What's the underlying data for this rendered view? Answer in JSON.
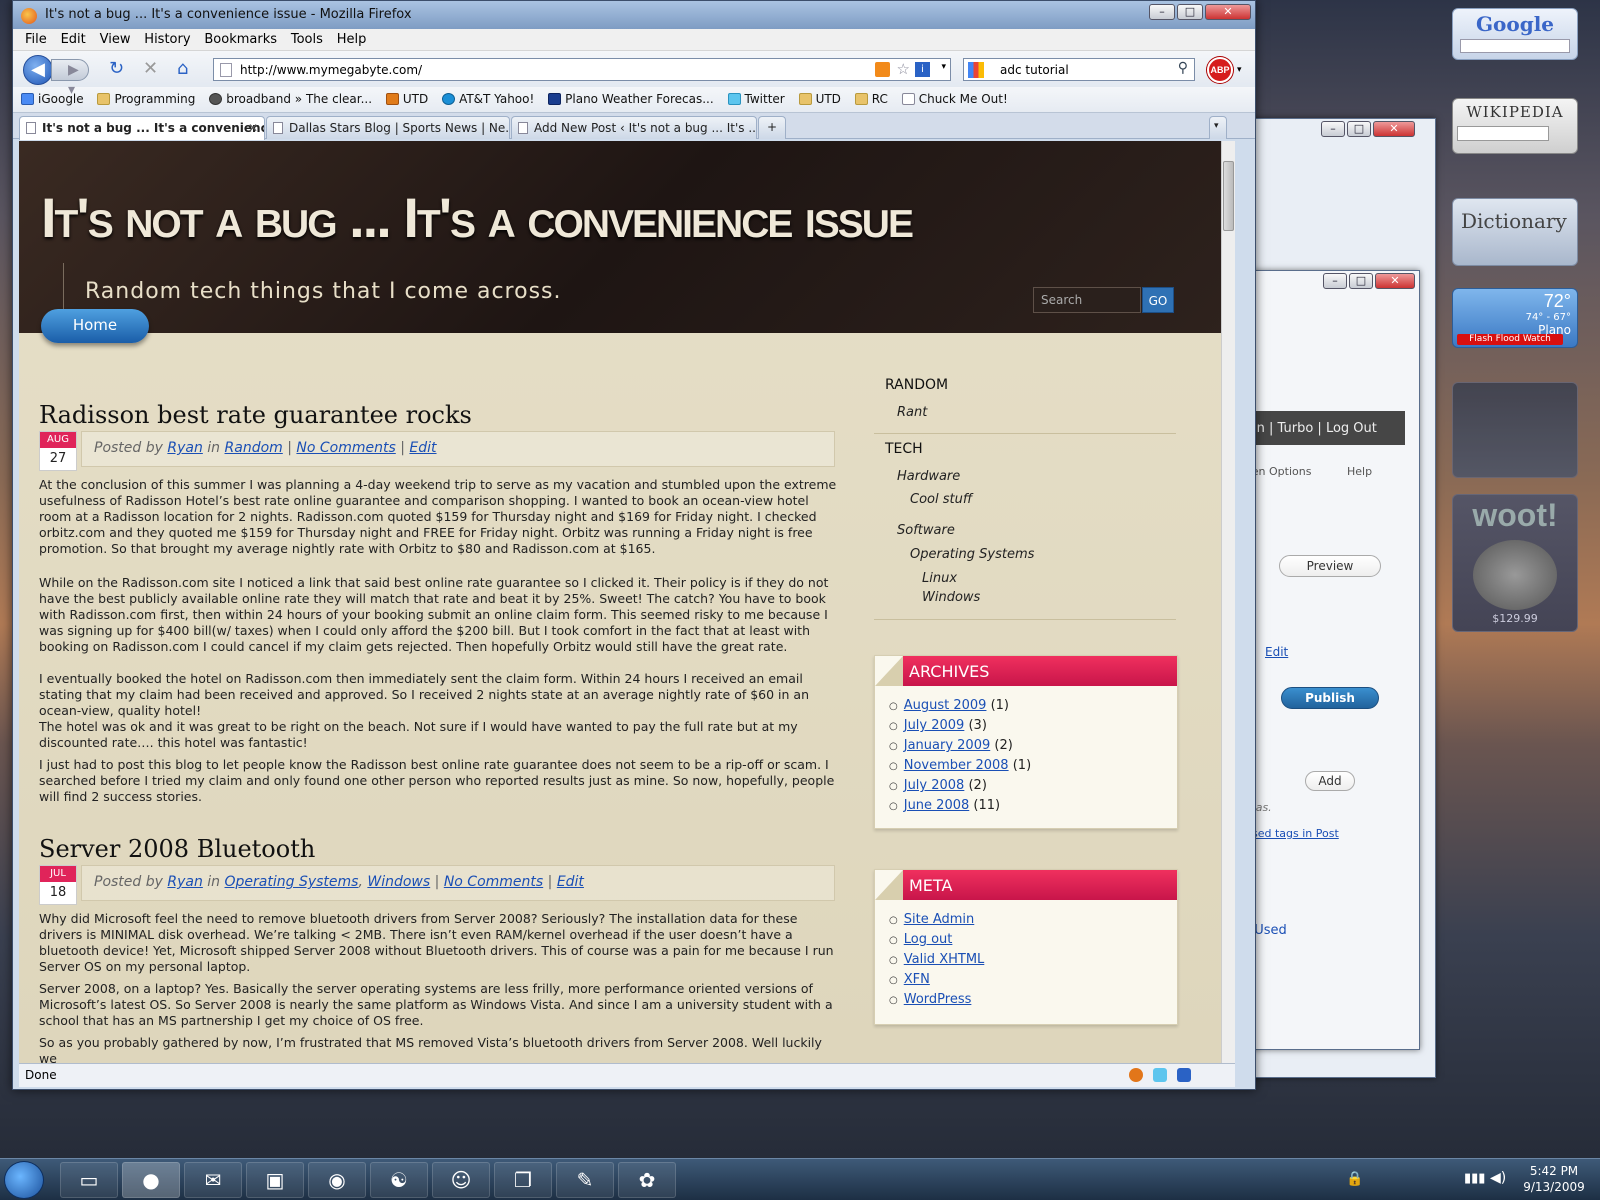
{
  "window": {
    "title": "It's not a bug ... It's a convenience issue - Mozilla Firefox"
  },
  "menu": [
    "File",
    "Edit",
    "View",
    "History",
    "Bookmarks",
    "Tools",
    "Help"
  ],
  "nav": {
    "url": "http://www.mymegabyte.com/",
    "search": "adc tutorial",
    "abp": "ABP"
  },
  "bookmarks": [
    "iGoogle",
    "Programming",
    "broadband » The clear...",
    "UTD",
    "AT&T Yahoo!",
    "Plano Weather Forecas...",
    "Twitter",
    "UTD",
    "RC",
    "Chuck Me Out!"
  ],
  "tabs": [
    "It's not a bug ... It's a convenienc...",
    "Dallas Stars Blog | Sports News | Ne...",
    "Add New Post ‹ It's not a bug ... It's ..."
  ],
  "site": {
    "title": "It's not a bug ... It's a convenience issue",
    "tagline": "Random tech things that I come across.",
    "search_placeholder": "Search",
    "go": "GO",
    "home": "Home"
  },
  "posts": [
    {
      "title": "Radisson best rate guarantee rocks",
      "month": "AUG",
      "day": "27",
      "meta": {
        "posted_by": "Posted by",
        "author": "Ryan",
        "in": "in",
        "category": "Random",
        "comments": "No Comments",
        "edit": "Edit"
      },
      "paragraphs": [
        "At the conclusion of this summer I was planning a 4-day weekend trip to serve as my vacation and stumbled upon the extreme usefulness of Radisson Hotel’s best rate online guarantee and comparison shopping. I wanted to book an ocean-view hotel room at a Radisson location for 2 nights. Radisson.com quoted $159 for Thursday night and $169 for Friday night. I checked orbitz.com and they quoted me $159 for Thursday night and FREE for Friday night. Orbitz was running a Friday night is free promotion. So that brought my average nightly rate with Orbitz to $80 and Radisson.com at $165.",
        "While on the Radisson.com site I noticed a link that said best online rate guarantee so I clicked it. Their policy is if they do not have the best publicly available online rate they will match that rate and beat it by 25%. Sweet! The catch? You have to book with Radisson.com first, then within 24 hours of your booking submit an online claim form. This seemed risky to me because I was signing up for $400 bill(w/ taxes) when I could only afford the $200 bill. But I took comfort in the fact that at least with booking on Radisson.com I could cancel if my claim gets rejected. Then hopefully Orbitz would still have the great rate.",
        "I eventually booked the hotel on Radisson.com then immediately sent the claim form. Within 24 hours I received an email stating that my claim had been received and approved. So I received 2 nights state at an average nightly rate of $60 in an ocean-view, quality hotel!",
        "The hotel was ok and it was great to be right on the beach. Not sure if I would have wanted to pay the full rate but at my discounted rate…. this hotel was fantastic!",
        "I just had to post this blog to let people know the Radisson best online rate guarantee does not seem to be a rip-off or scam. I searched before I tried my claim and only found one other person who reported results just as mine. So now, hopefully, people will find 2 success stories."
      ]
    },
    {
      "title": "Server 2008 Bluetooth",
      "month": "JUL",
      "day": "18",
      "meta": {
        "posted_by": "Posted by",
        "author": "Ryan",
        "in": "in",
        "category": "Operating Systems",
        "category2": "Windows",
        "comments": "No Comments",
        "edit": "Edit"
      },
      "paragraphs": [
        "Why did Microsoft feel the need to remove bluetooth drivers from Server 2008? Seriously? The installation data for these drivers is MINIMAL disk overhead. We’re talking < 2MB. There isn’t even RAM/kernel overhead if the user doesn’t have a bluetooth device! Yet, Microsoft shipped Server 2008 without Bluetooth drivers. This of course was a pain for me because I run Server OS on my personal laptop.",
        "Server 2008, on a laptop? Yes. Basically the server operating systems are less frilly, more performance oriented versions of Microsoft’s latest OS. So Server 2008 is nearly the same platform as Windows Vista. And since I am a university student with a school that has an MS partnership I get my choice of OS free.",
        "So as you probably gathered by now, I’m frustrated that MS removed Vista’s bluetooth drivers from Server 2008. Well luckily we"
      ]
    }
  ],
  "sidebar": {
    "random": "RANDOM",
    "rant": "Rant",
    "tech": "TECH",
    "hardware": "Hardware",
    "cool_stuff": "Cool stuff",
    "software": "Software",
    "operating_systems": "Operating Systems",
    "linux": "Linux",
    "windows": "Windows",
    "archives_title": "ARCHIVES",
    "archives": [
      {
        "month": "August 2009",
        "count": "(1)"
      },
      {
        "month": "July 2009",
        "count": "(3)"
      },
      {
        "month": "January 2009",
        "count": "(2)"
      },
      {
        "month": "November 2008",
        "count": "(1)"
      },
      {
        "month": "July 2008",
        "count": "(2)"
      },
      {
        "month": "June 2008",
        "count": "(11)"
      }
    ],
    "meta_title": "META",
    "meta": [
      "Site Admin",
      "Log out",
      "Valid XHTML",
      "XFN",
      "WordPress"
    ]
  },
  "status": "Done",
  "bg_window": {
    "links": "yan | Turbo | Log Out",
    "screen_options": "een Options",
    "help": "Help",
    "preview": "Preview",
    "edit": "Edit",
    "publish": "Publish",
    "add": "Add",
    "tags_hint": "mas.",
    "used_tags": "used tags in Post",
    "used": "t Used"
  },
  "gadgets": {
    "google": "Google",
    "wikipedia": "WIKIPEDIA",
    "dictionary": "Dictionary",
    "temp": "72°",
    "hilo": "74° - 67°",
    "city": "Plano",
    "alert": "Flash Flood Watch",
    "woot": "woot!",
    "woot_price": "$129.99"
  },
  "clock": {
    "time": "5:42 PM",
    "date": "9/13/2009"
  }
}
